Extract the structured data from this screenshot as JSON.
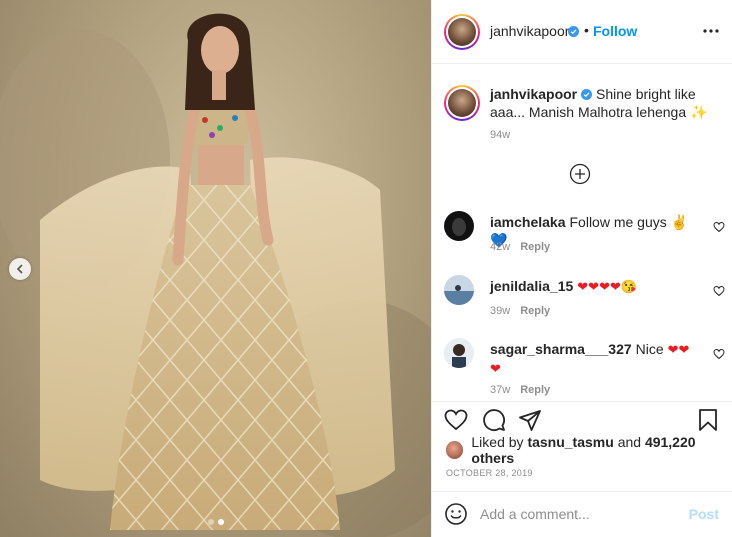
{
  "post": {
    "author": "janhvikapoor",
    "verified": true,
    "follow_label": "Follow",
    "bullet": "•",
    "caption": "Shine bright like aaa... Manish Malhotra lehenga",
    "caption_emoji": "✨",
    "caption_time": "94w",
    "media": {
      "slide_count": 2,
      "active_slide": 2
    }
  },
  "comments": [
    {
      "username": "iamchelaka",
      "text": "Follow me guys",
      "emoji": "✌💙",
      "time": "42w",
      "reply_label": "Reply"
    },
    {
      "username": "jenildalia_15",
      "text": "",
      "emoji": "❤❤❤❤😘",
      "time": "39w",
      "reply_label": "Reply"
    },
    {
      "username": "sagar_sharma___327",
      "text": "Nice",
      "emoji": "❤❤ ❤",
      "time": "37w",
      "reply_label": "Reply"
    }
  ],
  "likes": {
    "liked_by_prefix": "Liked by",
    "liked_by_user": "tasnu_tasmu",
    "and_label": "and",
    "others": "491,220 others"
  },
  "date": "OCTOBER 28, 2019",
  "comment_box": {
    "placeholder": "Add a comment...",
    "post_label": "Post"
  },
  "icons": {
    "more": "more-dots-icon",
    "load_more": "plus-circle-icon",
    "like": "heart-icon",
    "comment": "comment-bubble-icon",
    "share": "paper-plane-icon",
    "save": "bookmark-icon",
    "emoji": "smile-icon",
    "prev": "chevron-left-icon"
  },
  "colors": {
    "link_blue": "#0095f6",
    "muted": "#8e8e8e",
    "post_disabled": "#b2dffc",
    "verified_blue": "#3897f0"
  }
}
